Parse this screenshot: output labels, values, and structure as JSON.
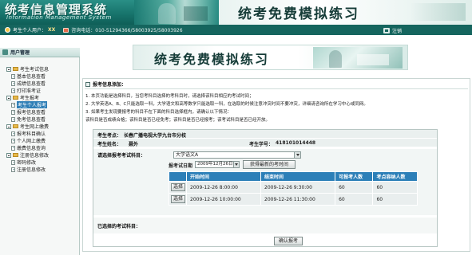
{
  "banner": {
    "system_title": "统考信息管理系统",
    "system_title_en": "Information Management System",
    "exam_title": "统考免费模拟练习"
  },
  "infobar": {
    "user_prefix": "考生个人用户：",
    "user_name": "XX",
    "phone_label": "咨询电话：010-51294366/58003925/58003926",
    "logout_label": "注销"
  },
  "sidebar": {
    "header": "用户管理",
    "groups": [
      {
        "label": "考生考试信息",
        "items": [
          "基本信息查看",
          "成绩信息查看",
          "打印准考证"
        ]
      },
      {
        "label": "考生报考",
        "items": [
          "考生个人报考",
          "报考信息查看",
          "免考信息查看"
        ]
      },
      {
        "label": "考生网上缴费",
        "items": [
          "报考科目确认",
          "个人网上缴费",
          "缴费信息查询"
        ]
      },
      {
        "label": "注册信息修改",
        "items": [
          "密码修改",
          "注册信息修改"
        ]
      }
    ],
    "active_item": "考生个人报考"
  },
  "main": {
    "banner_title": "统考免费模拟练习",
    "panel_title": "报考信息添加：",
    "notes": [
      "1. 本页功能是选择科目，当您考科目选择的考科目时，请选择该科目相应的考试时间；",
      "2. 大学英语A、B、C只能选取一科，大学语文和高等数学只能选取一科，在选取的时候注意冲突时间不要冲突，详细请咨询所在学习中心或同网。",
      "3. 如果考生发现要报考的科目不在下面的科目选择框内，请确认以下情况：",
      "   该科目是否成绩合格；该科目是否已经免考；该科目是否已经报考；该考试科目是否已经开放。"
    ],
    "form": {
      "site_label": "考生考点：",
      "site_value": "长春广播电视大学九台市分校",
      "name_label": "考生姓名：",
      "name_value": "聂外",
      "id_label": "考生学号：",
      "id_value": "418101014448",
      "subject_label": "请选择报考考试科目：",
      "subject_value": "大学语文A",
      "time_label": "报考试日期",
      "date_value": "2009年12月26日",
      "fetch_button": "获得最新的考时间",
      "table": {
        "headers": [
          "",
          "开始时间",
          "结束时间",
          "可报考人数",
          "考点容纳人数"
        ],
        "rows": [
          {
            "button": "选择",
            "start": "2009-12-26 8:00:00",
            "end": "2009-12-26 9:30:00",
            "available": "60",
            "capacity": "60"
          },
          {
            "button": "选择",
            "start": "2009-12-26 10:00:00",
            "end": "2009-12-26 11:30:00",
            "available": "60",
            "capacity": "60"
          }
        ]
      },
      "chosen_label": "已选择的考试科目：",
      "confirm_button": "确认报考"
    }
  }
}
